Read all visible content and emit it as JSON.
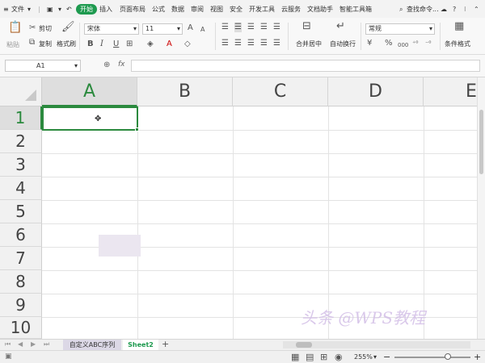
{
  "menubar": {
    "file_label": "文件",
    "tabs": [
      "开始",
      "插入",
      "页面布局",
      "公式",
      "数据",
      "审阅",
      "视图",
      "安全",
      "开发工具",
      "云服务",
      "文档助手",
      "智能工具箱"
    ],
    "search_label": "查找命令..."
  },
  "ribbon": {
    "paste_label": "粘贴",
    "cut_label": "剪切",
    "copy_label": "复制",
    "format_painter_label": "格式刷",
    "font_name": "宋体",
    "font_size": "11",
    "bold": "B",
    "italic": "I",
    "underline": "U",
    "grow_font": "A",
    "shrink_font": "A",
    "merge_label": "合并居中",
    "wrap_label": "自动换行",
    "number_format": "常规",
    "percent": "%",
    "thousands": "000",
    "conditional_label": "条件格式"
  },
  "formula_bar": {
    "name_box": "A1",
    "fx": "fx",
    "value": ""
  },
  "sheet": {
    "columns": [
      "A",
      "B",
      "C",
      "D",
      "E"
    ],
    "rows": [
      "1",
      "2",
      "3",
      "4",
      "5",
      "6",
      "7",
      "8",
      "9",
      "10"
    ],
    "active_cell": "A1"
  },
  "watermark": "头条 @WPS教程",
  "tabs": {
    "sheets": [
      "自定义ABC序列",
      "Sheet2"
    ],
    "active_sheet": "Sheet2",
    "add": "+"
  },
  "status": {
    "zoom": "255%"
  },
  "colors": {
    "accent": "#1e9a4f",
    "selection": "#2b8a3e"
  }
}
